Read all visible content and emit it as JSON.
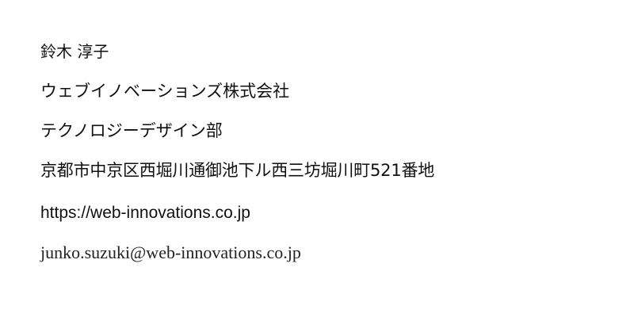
{
  "contact": {
    "name": "鈴木 淳子",
    "company": "ウェブイノベーションズ株式会社",
    "department": "テクノロジーデザイン部",
    "address": "京都市中京区西堀川通御池下ル西三坊堀川町521番地",
    "website": "https://web-innovations.co.jp",
    "email": "junko.suzuki@web-innovations.co.jp"
  }
}
